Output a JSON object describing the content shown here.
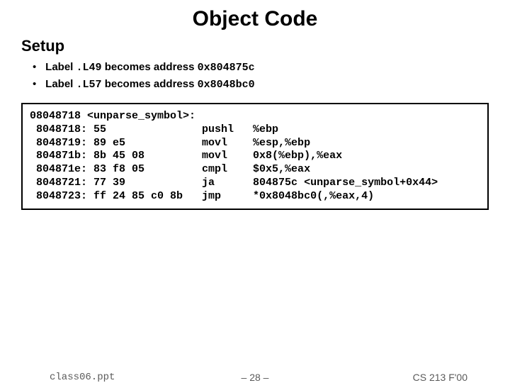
{
  "title": "Object Code",
  "subhead": "Setup",
  "bullets": [
    {
      "prefix": "Label ",
      "code1": ".L49",
      "mid": " becomes address ",
      "code2": "0x804875c"
    },
    {
      "prefix": "Label ",
      "code1": ".L57",
      "mid": " becomes address ",
      "code2": "0x8048bc0"
    }
  ],
  "code": "08048718 <unparse_symbol>:\n 8048718: 55               pushl   %ebp\n 8048719: 89 e5            movl    %esp,%ebp\n 804871b: 8b 45 08         movl    0x8(%ebp),%eax\n 804871e: 83 f8 05         cmpl    $0x5,%eax\n 8048721: 77 39            ja      804875c <unparse_symbol+0x44>\n 8048723: ff 24 85 c0 8b   jmp     *0x8048bc0(,%eax,4)",
  "footer": {
    "left": "class06.ppt",
    "center": "– 28 –",
    "right": "CS 213 F'00"
  }
}
